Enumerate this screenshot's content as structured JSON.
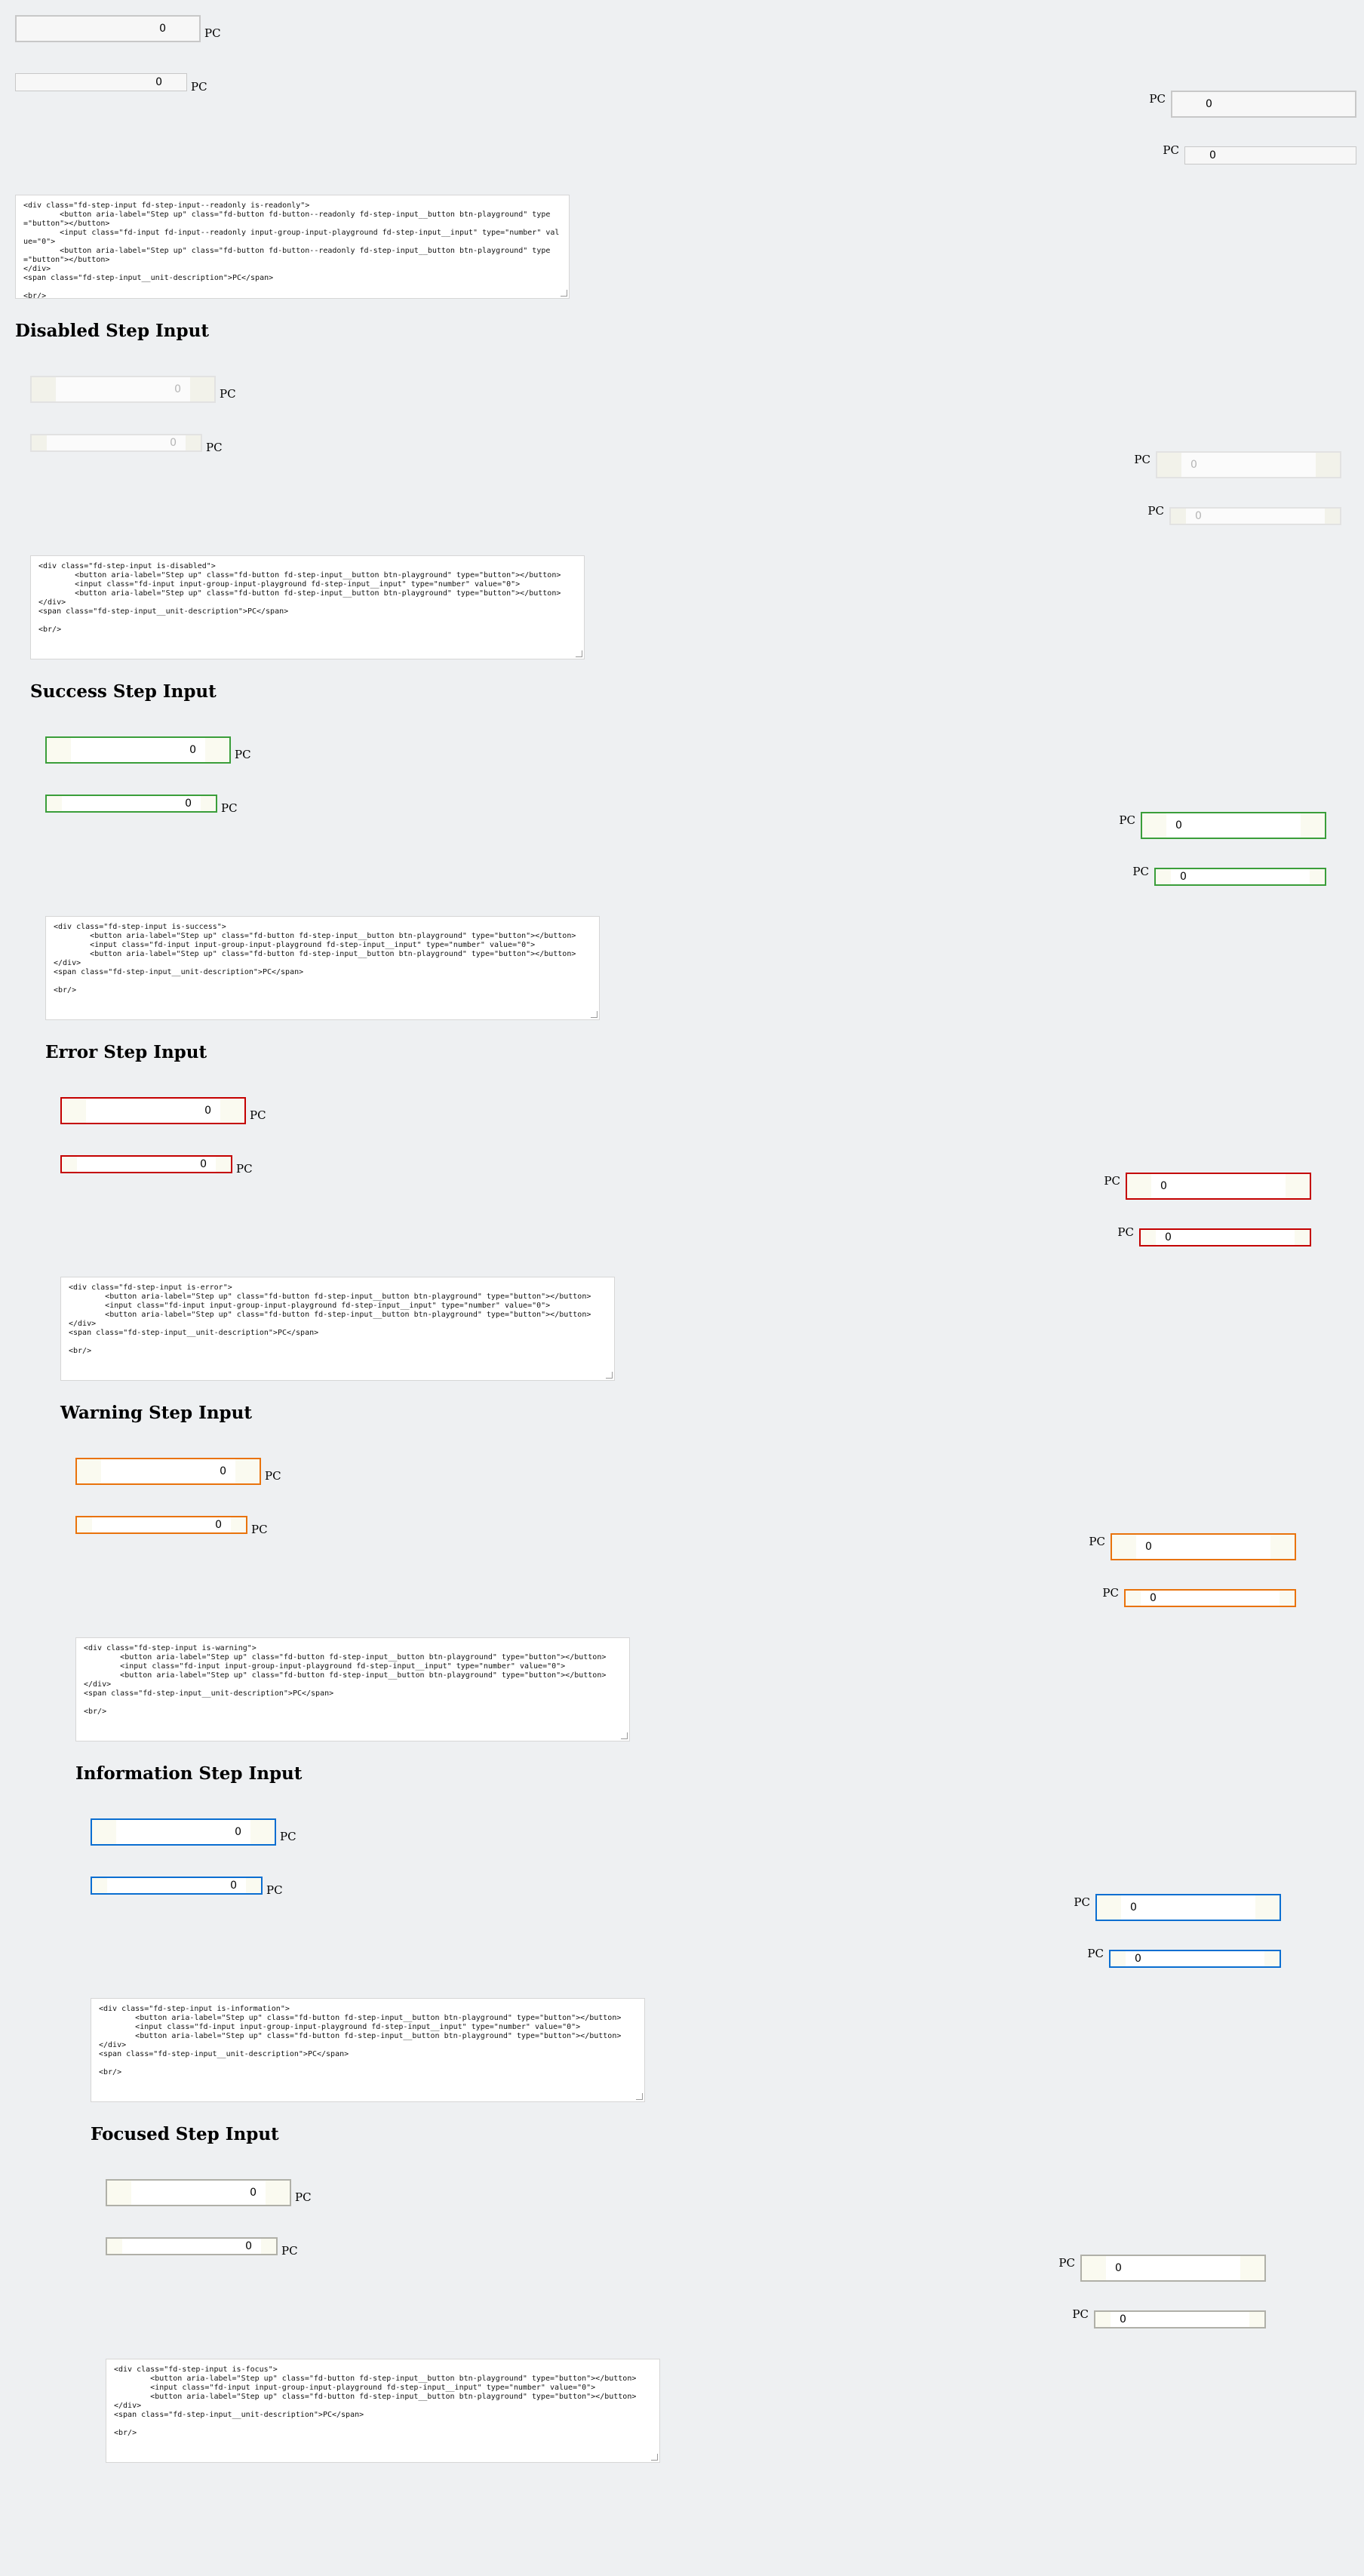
{
  "unit": "PC",
  "sections": [
    {
      "state": "readonly",
      "title": "",
      "value": "0",
      "code": "<div class=\"fd-step-input fd-step-input--readonly is-readonly\">\n        <button aria-label=\"Step up\" class=\"fd-button fd-button--readonly fd-step-input__button btn-playground\" type=\"button\"></button>\n        <input class=\"fd-input fd-input--readonly input-group-input-playground fd-step-input__input\" type=\"number\" value=\"0\">\n        <button aria-label=\"Step up\" class=\"fd-button fd-button--readonly fd-step-input__button btn-playground\" type=\"button\"></button>\n</div>\n<span class=\"fd-step-input__unit-description\">PC</span>\n\n<br/>"
    },
    {
      "state": "disabled",
      "title": "Disabled Step Input",
      "value": "0",
      "code": "<div class=\"fd-step-input is-disabled\">\n        <button aria-label=\"Step up\" class=\"fd-button fd-step-input__button btn-playground\" type=\"button\"></button>\n        <input class=\"fd-input input-group-input-playground fd-step-input__input\" type=\"number\" value=\"0\">\n        <button aria-label=\"Step up\" class=\"fd-button fd-step-input__button btn-playground\" type=\"button\"></button>\n</div>\n<span class=\"fd-step-input__unit-description\">PC</span>\n\n<br/>"
    },
    {
      "state": "success",
      "title": "Success Step Input",
      "value": "0",
      "code": "<div class=\"fd-step-input is-success\">\n        <button aria-label=\"Step up\" class=\"fd-button fd-step-input__button btn-playground\" type=\"button\"></button>\n        <input class=\"fd-input input-group-input-playground fd-step-input__input\" type=\"number\" value=\"0\">\n        <button aria-label=\"Step up\" class=\"fd-button fd-step-input__button btn-playground\" type=\"button\"></button>\n</div>\n<span class=\"fd-step-input__unit-description\">PC</span>\n\n<br/>"
    },
    {
      "state": "error",
      "title": "Error Step Input",
      "value": "0",
      "code": "<div class=\"fd-step-input is-error\">\n        <button aria-label=\"Step up\" class=\"fd-button fd-step-input__button btn-playground\" type=\"button\"></button>\n        <input class=\"fd-input input-group-input-playground fd-step-input__input\" type=\"number\" value=\"0\">\n        <button aria-label=\"Step up\" class=\"fd-button fd-step-input__button btn-playground\" type=\"button\"></button>\n</div>\n<span class=\"fd-step-input__unit-description\">PC</span>\n\n<br/>"
    },
    {
      "state": "warning",
      "title": "Warning Step Input",
      "value": "0",
      "code": "<div class=\"fd-step-input is-warning\">\n        <button aria-label=\"Step up\" class=\"fd-button fd-step-input__button btn-playground\" type=\"button\"></button>\n        <input class=\"fd-input input-group-input-playground fd-step-input__input\" type=\"number\" value=\"0\">\n        <button aria-label=\"Step up\" class=\"fd-button fd-step-input__button btn-playground\" type=\"button\"></button>\n</div>\n<span class=\"fd-step-input__unit-description\">PC</span>\n\n<br/>"
    },
    {
      "state": "information",
      "title": "Information Step Input",
      "value": "0",
      "code": "<div class=\"fd-step-input is-information\">\n        <button aria-label=\"Step up\" class=\"fd-button fd-step-input__button btn-playground\" type=\"button\"></button>\n        <input class=\"fd-input input-group-input-playground fd-step-input__input\" type=\"number\" value=\"0\">\n        <button aria-label=\"Step up\" class=\"fd-button fd-step-input__button btn-playground\" type=\"button\"></button>\n</div>\n<span class=\"fd-step-input__unit-description\">PC</span>\n\n<br/>"
    },
    {
      "state": "focus",
      "title": "Focused Step Input",
      "value": "0",
      "code": "<div class=\"fd-step-input is-focus\">\n        <button aria-label=\"Step up\" class=\"fd-button fd-step-input__button btn-playground\" type=\"button\"></button>\n        <input class=\"fd-input input-group-input-playground fd-step-input__input\" type=\"number\" value=\"0\">\n        <button aria-label=\"Step up\" class=\"fd-button fd-step-input__button btn-playground\" type=\"button\"></button>\n</div>\n<span class=\"fd-step-input__unit-description\">PC</span>\n\n<br/>"
    }
  ]
}
